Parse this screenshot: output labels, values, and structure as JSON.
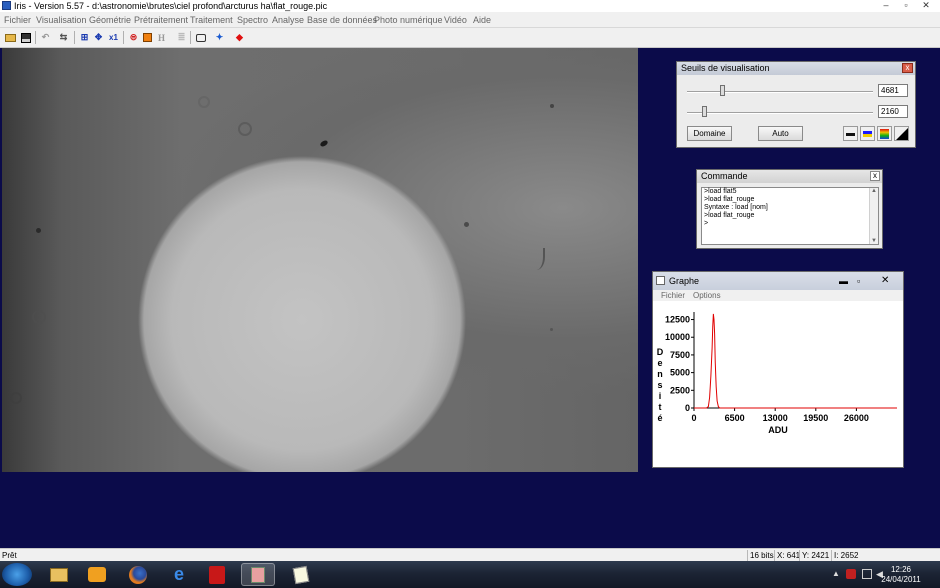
{
  "window": {
    "title": "Iris - Version 5.57 - d:\\astronomie\\brutes\\ciel profond\\arcturus ha\\flat_rouge.pic"
  },
  "menu": [
    "Fichier",
    "Visualisation",
    "Géométrie",
    "Prétraitement",
    "Traitement",
    "Spectro",
    "Analyse",
    "Base de données",
    "Photo numérique",
    "Vidéo",
    "Aide"
  ],
  "toolbar": {
    "scale_label": "x1",
    "h_label": "H"
  },
  "seuils": {
    "title": "Seuils de visualisation",
    "high_value": "4681",
    "low_value": "2160",
    "high_level": 0.19,
    "low_level": 0.09,
    "domaine_label": "Domaine",
    "auto_label": "Auto"
  },
  "commande": {
    "title": "Commande",
    "lines": [
      ">load flat5",
      ">load flat_rouge",
      "Syntaxe : load [nom]",
      ">load flat_rouge",
      ">"
    ]
  },
  "graphe": {
    "title": "Graphe",
    "menu": [
      "Fichier",
      "Options"
    ],
    "ylabel_letters": [
      "D",
      "e",
      "n",
      "s",
      "i",
      "t",
      "é"
    ]
  },
  "chart_data": {
    "type": "line",
    "title": "",
    "xlabel": "ADU",
    "ylabel": "Densité",
    "xlim": [
      0,
      32500
    ],
    "ylim": [
      0,
      13000
    ],
    "x_ticks": [
      0,
      6500,
      13000,
      19500,
      26000
    ],
    "y_ticks": [
      0,
      2500,
      5000,
      7500,
      10000,
      12500
    ],
    "grid": false,
    "series": [
      {
        "color": "#e00000",
        "x": [
          0,
          2000,
          2300,
          2500,
          2700,
          2900,
          3000,
          3100,
          3200,
          3300,
          3400,
          3550,
          3700,
          3900,
          4100,
          32500
        ],
        "y": [
          0,
          0,
          200,
          1500,
          4500,
          8500,
          11500,
          13300,
          12500,
          10500,
          6500,
          3000,
          1000,
          200,
          0,
          0
        ]
      }
    ]
  },
  "statusbar": {
    "ready": "Prêt",
    "bits": "16 bits",
    "x": "X: 641",
    "y": "Y: 2421",
    "i": "I: 2652"
  },
  "taskbar": {
    "time": "12:26",
    "date": "24/04/2011"
  }
}
